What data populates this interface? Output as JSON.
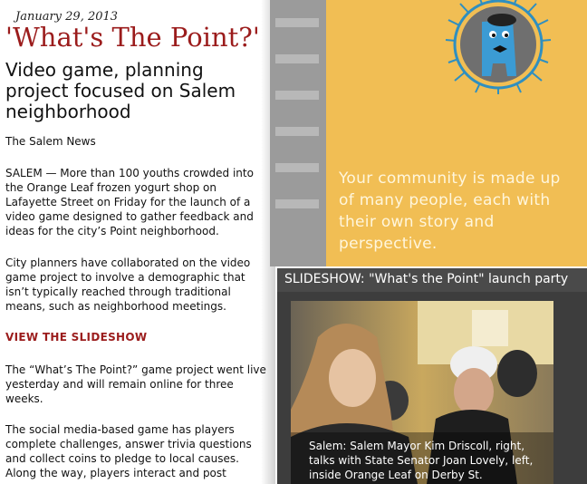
{
  "article": {
    "date": "January 29, 2013",
    "headline": "'What's The Point?'",
    "subhead": "Video game, planning project focused on Salem neighborhood",
    "source": "The Salem News",
    "paragraphs": [
      "SALEM — More than 100 youths crowded into the Orange Leaf frozen yogurt shop on Lafayette Street on Friday for the launch of a video game designed to gather feedback and ideas for the city’s Point neighborhood.",
      "City planners have collaborated on the video game project to involve a demographic that isn’t typically reached through traditional means, such as neighborhood meetings.",
      "The “What’s The Point?” game project went live yesterday and will remain online for three weeks.",
      "The social media-based game has players complete challenges, answer trivia questions and collect coins to pledge to local causes. Along the way, players interact and post"
    ],
    "slideshow_link": "VIEW THE SLIDESHOW"
  },
  "game": {
    "tagline": "Your community is made up of many people, each with their own story and perspective."
  },
  "slideshow": {
    "title": "SLIDESHOW: \"What's the Point\" launch party",
    "caption": "Salem: Salem Mayor Kim Driscoll, right, talks with State Senator Joan Lovely, left, inside Orange Leaf on Derby St."
  },
  "colors": {
    "headline": "#9b1c1c",
    "game_bg": "#f1be54",
    "badge": "#2f8fc0"
  }
}
